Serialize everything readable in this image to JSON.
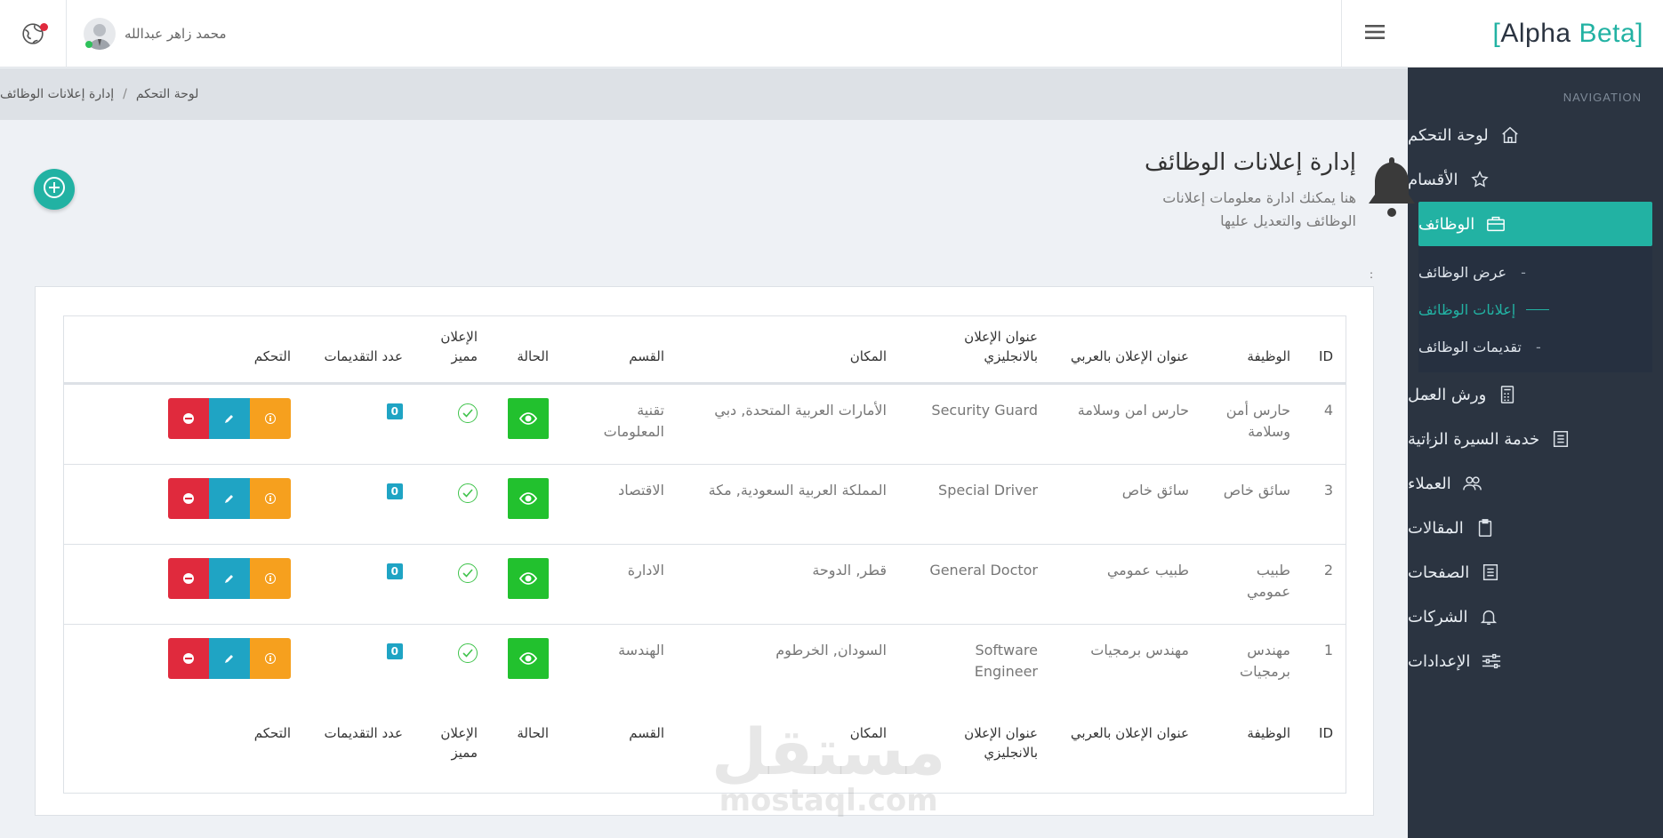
{
  "brand": {
    "left_bracket": "[",
    "alpha": "Alpha",
    "beta": "Beta",
    "right_bracket": "]"
  },
  "user": {
    "name": "محمد زاهر عبدالله"
  },
  "breadcrumb": {
    "home": "لوحة التحكم",
    "separator": "/",
    "current": "إدارة إعلانات الوظائف"
  },
  "header": {
    "title": "إدارة إعلانات الوظائف",
    "subtitle": "هنا يمكنك ادارة معلومات إعلانات الوظائف والتعديل عليها"
  },
  "misc": {
    "colon_mark": ":"
  },
  "sidebar": {
    "caption": "NAVIGATION",
    "items": [
      {
        "label": "لوحة التحكم",
        "icon": "home-icon",
        "chev": ""
      },
      {
        "label": "الأقسام",
        "icon": "star-icon",
        "chev": "⌄"
      },
      {
        "label": "الوظائف",
        "icon": "briefcase-icon",
        "chev": "⌄"
      },
      {
        "label": "ورش العمل",
        "icon": "calculator-icon",
        "chev": "⌄"
      },
      {
        "label": "خدمة السيرة الزاتية",
        "icon": "document-icon",
        "chev": "⌄"
      },
      {
        "label": "العملاء",
        "icon": "users-icon",
        "chev": ""
      },
      {
        "label": "المقالات",
        "icon": "clipboard-icon",
        "chev": "⌄"
      },
      {
        "label": "الصفحات",
        "icon": "pages-icon",
        "chev": ""
      },
      {
        "label": "الشركات",
        "icon": "bell-icon",
        "chev": ""
      },
      {
        "label": "الإعدادات",
        "icon": "sliders-icon",
        "chev": ""
      }
    ],
    "sub_items": [
      {
        "label": "عرض الوظائف",
        "dash": "-"
      },
      {
        "label": "إعلانات الوظائف",
        "dash": ""
      },
      {
        "label": "تقديمات الوظائف",
        "dash": "-"
      }
    ]
  },
  "table": {
    "headers": {
      "id": "ID",
      "job": "الوظيفة",
      "title_ar": "عنوان الإعلان بالعربي",
      "title_en": "عنوان الإعلان بالانجليزي",
      "location": "المكان",
      "department": "القسم",
      "status": "الحالة",
      "featured": "الإعلان مميز",
      "count": "عدد التقديمات",
      "control": "التحكم"
    },
    "rows": [
      {
        "id": "4",
        "job": "حارس أمن وسلامة",
        "title_ar": "حارس امن وسلامة",
        "title_en": "Security Guard",
        "location": "الأمارات العربية المتحدة, دبي",
        "department": "تقنية المعلومات",
        "count": "0"
      },
      {
        "id": "3",
        "job": "سائق خاص",
        "title_ar": "سائق خاص",
        "title_en": "Special Driver",
        "location": "المملكة العربية السعودية, مكة",
        "department": "الاقتصاد",
        "count": "0"
      },
      {
        "id": "2",
        "job": "طبيب عمومي",
        "title_ar": "طبيب عمومي",
        "title_en": "General Doctor",
        "location": "قطر, الدوحة",
        "department": "الادارة",
        "count": "0"
      },
      {
        "id": "1",
        "job": "مهندس برمجيات",
        "title_ar": "مهندس برمجيات",
        "title_en": "Software Engineer",
        "location": "السودان, الخرطوم",
        "department": "الهندسة",
        "count": "0"
      }
    ]
  },
  "watermark": {
    "arabic": "مستقل",
    "latin": "mostaql.com"
  },
  "colors": {
    "accent": "#22b2a3",
    "sidebar_bg": "#2b3441",
    "view": "#22c12e",
    "delete": "#e02a3d",
    "edit": "#1fa4c4",
    "info": "#f6a01e"
  }
}
